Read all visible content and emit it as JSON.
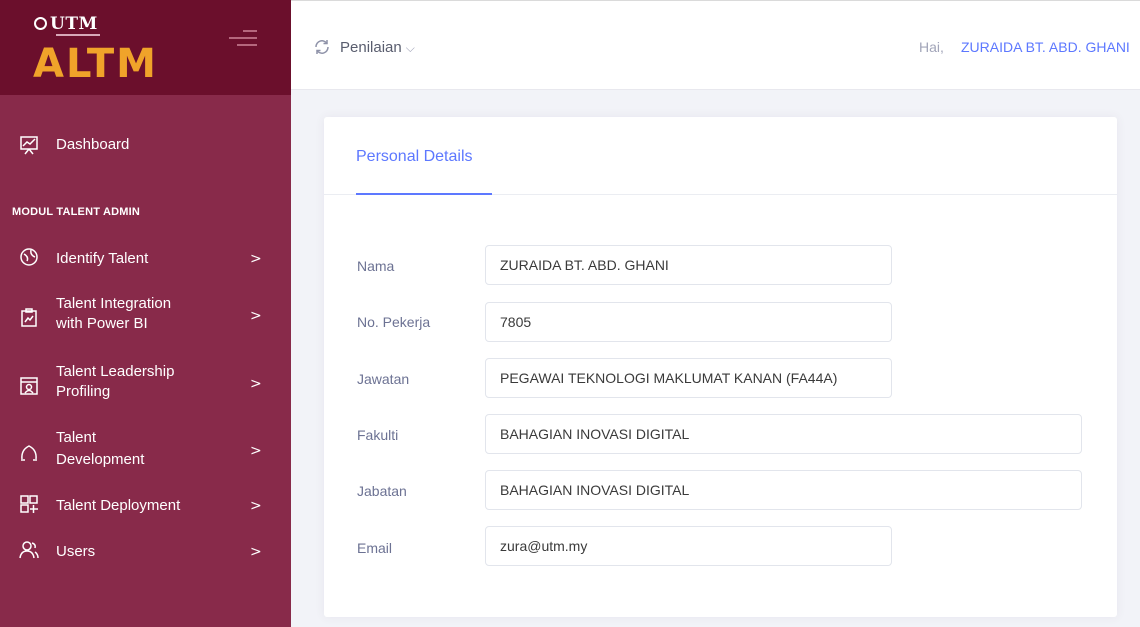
{
  "brand": {
    "utm_label": "UTM",
    "altm_label": "ALTM",
    "primary_color": "#882a4a",
    "header_color": "#6b0f2c",
    "logo_accent": "#f0a32a"
  },
  "sidebar": {
    "dashboard_label": "Dashboard",
    "section_title": "MODUL TALENT ADMIN",
    "items": [
      {
        "label_line1": "Identify Talent",
        "label_line2": "",
        "icon": "globe-icon"
      },
      {
        "label_line1": "Talent Integration",
        "label_line2": "with Power BI",
        "icon": "chart-icon"
      },
      {
        "label_line1": "Talent Leadership",
        "label_line2": "Profiling",
        "icon": "presentation-icon"
      },
      {
        "label_line1": "Talent",
        "label_line2": "Development",
        "icon": "sprout-icon"
      },
      {
        "label_line1": "Talent Deployment",
        "label_line2": "",
        "icon": "grid-plus-icon"
      },
      {
        "label_line1": "Users",
        "label_line2": "",
        "icon": "users-icon"
      }
    ],
    "chevron": ">"
  },
  "topbar": {
    "menu_label": "Penilaian",
    "menu_caret": "⌵",
    "greeting": "Hai,",
    "user_name": "ZURAIDA BT. ABD. GHANI",
    "accent_color": "#5d78ff"
  },
  "card": {
    "tab_title": "Personal Details",
    "fields": [
      {
        "label": "Nama",
        "value": " ZURAIDA BT. ABD. GHANI"
      },
      {
        "label": "No. Pekerja",
        "value": "7805"
      },
      {
        "label": "Jawatan",
        "value": "PEGAWAI TEKNOLOGI MAKLUMAT KANAN (FA44A)"
      },
      {
        "label": "Fakulti",
        "value": "BAHAGIAN INOVASI DIGITAL"
      },
      {
        "label": "Jabatan",
        "value": "BAHAGIAN INOVASI DIGITAL"
      },
      {
        "label": "Email",
        "value": "zura@utm.my"
      }
    ]
  }
}
